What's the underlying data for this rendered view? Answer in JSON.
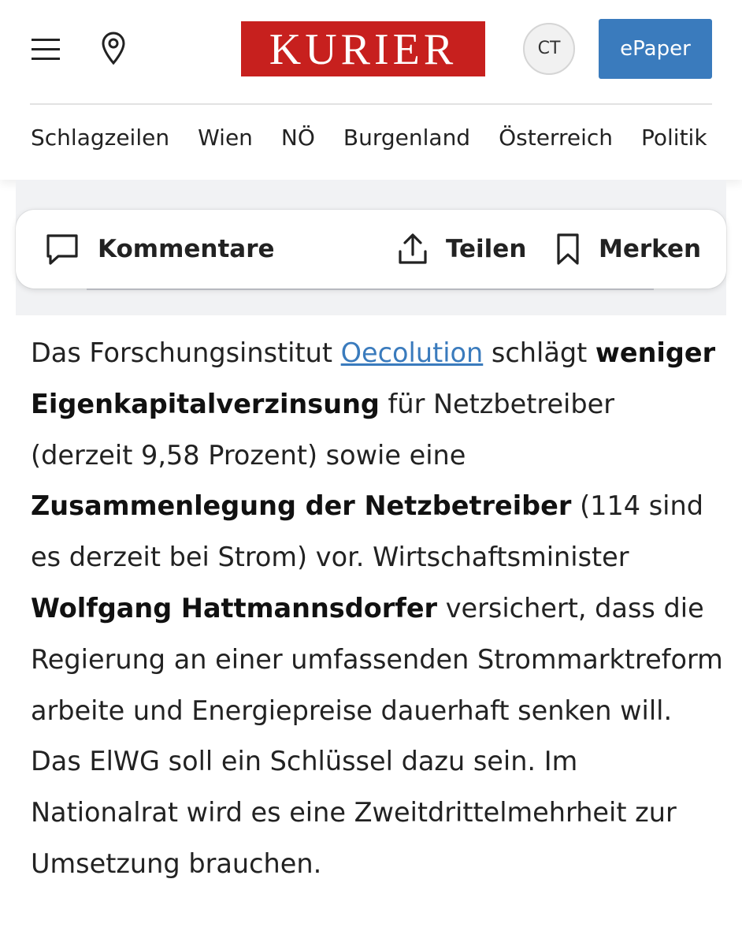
{
  "header": {
    "logo_text": "KURIER",
    "avatar_initials": "CT",
    "epaper_label": "ePaper",
    "nav_items": [
      "Schlagzeilen",
      "Wien",
      "NÖ",
      "Burgenland",
      "Österreich",
      "Politik"
    ]
  },
  "actions": {
    "comments_label": "Kommentare",
    "share_label": "Teilen",
    "bookmark_label": "Merken"
  },
  "article": {
    "t1": "Das Forschungsinstitut ",
    "link": "Oecolution",
    "t2": " schlägt ",
    "b1": "weniger Eigenkapitalverzinsung",
    "t3": " für Netzbetreiber (derzeit 9,58 Prozent) sowie eine ",
    "b2": "Zusammenlegung der Netzbetreiber",
    "t4": " (114 sind es derzeit bei Strom) vor. Wirtschaftsminister ",
    "b3": "Wolfgang Hattmannsdorfer",
    "t5": " versichert, dass die Regierung an einer umfassenden Strommarktreform arbeite und Energiepreise dauerhaft senken will. Das ElWG soll ein Schlüssel dazu sein. Im Nationalrat wird es eine Zweitdrittelmehrheit zur Umsetzung brauchen."
  },
  "colors": {
    "brand_red": "#c7201e",
    "link_blue": "#3a7bbd",
    "epaper_bg": "#3a7bbd"
  },
  "icons": [
    "hamburger-menu-icon",
    "location-pin-icon",
    "speech-bubble-icon",
    "share-upload-icon",
    "bookmark-icon"
  ]
}
